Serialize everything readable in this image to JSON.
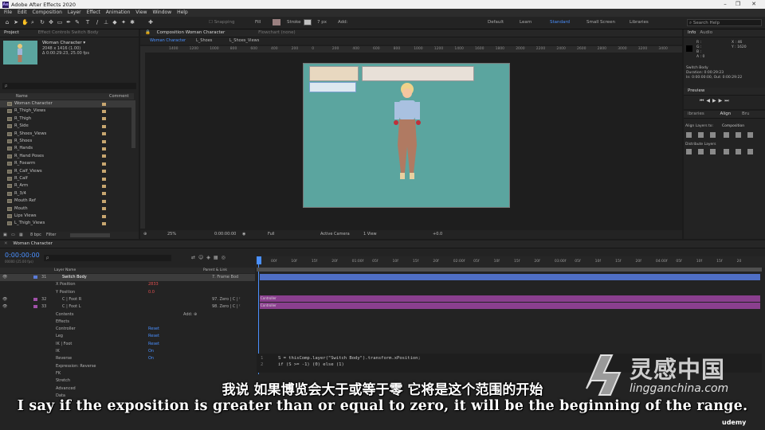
{
  "app": {
    "title": "Adobe After Effects 2020",
    "logo": "Ae",
    "window_buttons": [
      "–",
      "❐",
      "✕"
    ]
  },
  "menu": [
    "File",
    "Edit",
    "Composition",
    "Layer",
    "Effect",
    "Animation",
    "View",
    "Window",
    "Help"
  ],
  "toolbar": {
    "snapping": "Snapping",
    "fill": "Fill",
    "stroke": "Stroke",
    "stroke_px": "7 px",
    "add": "Add:",
    "workspaces": [
      "Default",
      "Learn",
      "Standard",
      "Small Screen",
      "Libraries"
    ],
    "active_workspace": "Standard",
    "search_placeholder": "Search Help"
  },
  "project": {
    "tab": "Project",
    "effect_controls_tab": "Effect Controls Switch Body",
    "comp_name": "Woman Character ▾",
    "comp_size": "2048 x 1416 (1.00)",
    "comp_duration": "Δ 0:00:29:23, 25.00 fps",
    "search_placeholder": "ρ",
    "col_name": "Name",
    "col_comment": "Comment",
    "items": [
      "Woman Character",
      "R_Thigh_Views",
      "R_Thigh",
      "R_Side",
      "R_Shoes_Views",
      "R_Shoes",
      "R_Hands",
      "R_Hand Poses",
      "R_Foearm",
      "R_Calf_Views",
      "R_Calf",
      "R_Arm",
      "R_3/4",
      "Mouth Ref",
      "Mouth",
      "Lips Views",
      "L_Thigh_Views"
    ],
    "footer_bpc": "8 bpc",
    "footer_filter": "Filter"
  },
  "composition": {
    "tab": "Composition Woman Character",
    "flowchart": "Flowchart (none)",
    "sub_tabs": [
      "Woman Character",
      "L_Shoes",
      "L_Shoes_Views"
    ],
    "ruler_labels": [
      "1400",
      "1200",
      "1000",
      "800",
      "600",
      "400",
      "200",
      "0",
      "200",
      "400",
      "600",
      "800",
      "1000",
      "1200",
      "1400",
      "1600",
      "1800",
      "2000",
      "2200",
      "2400",
      "2600",
      "2800",
      "3000",
      "3200",
      "3400"
    ],
    "zoom": "25%",
    "timecode": "0:00:00:00",
    "resolution": "Full",
    "camera": "Active Camera",
    "view": "1 View",
    "offset": "+0.0",
    "canvas_color": "#5ba59f"
  },
  "info": {
    "tab_info": "Info",
    "tab_audio": "Audio",
    "r": "R :",
    "g": "G :",
    "b": "B :",
    "a": "A : 0",
    "x": "X : 46",
    "y": "Y : 1620",
    "layer": "Switch Body",
    "duration": "Duration: 0:00:29:23",
    "inout": "In: 0:00:00:00, Out: 0:00:29:22"
  },
  "preview": {
    "tab": "Preview"
  },
  "align": {
    "tab_libraries": "ibraries",
    "tab_align": "Align",
    "tab_brush": "Bru",
    "align_to_label": "Align Layers to:",
    "align_to_value": "Composition",
    "distribute": "Distribute Layers"
  },
  "timeline": {
    "tab": "Woman Character",
    "timecode": "0:00:00:00",
    "timecode_sub": "00000 (25.00 fps)",
    "search_placeholder": "ρ",
    "col_layer_name": "Layer Name",
    "col_parent": "Parent & Link",
    "time_marks": [
      "00f",
      "10f",
      "15f",
      "20f",
      "01:00f",
      "05f",
      "10f",
      "15f",
      "20f",
      "02:00f",
      "05f",
      "10f",
      "15f",
      "20f",
      "03:00f",
      "05f",
      "10f",
      "15f",
      "20f",
      "04:00f",
      "05f",
      "10f",
      "15f",
      "20"
    ],
    "layers": [
      {
        "num": "31",
        "name": "Switch Body",
        "parent": "7. Frame Bod",
        "selected": true
      },
      {
        "num": "",
        "name": "X Position",
        "value": "2833",
        "prop": true
      },
      {
        "num": "",
        "name": "Y Position",
        "value": "0.0",
        "prop": true
      },
      {
        "num": "32",
        "name": "C | Foot R",
        "parent": "97. Zero | C | ⁽",
        "selected": false
      },
      {
        "num": "33",
        "name": "C | Foot L",
        "parent": "98. Zero | C | ⁽",
        "selected": false
      },
      {
        "num": "",
        "name": "Contents",
        "value": "Add: ⊕",
        "prop": true
      },
      {
        "num": "",
        "name": "Effects",
        "prop": true
      },
      {
        "num": "",
        "name": "Controller",
        "value": "Reset",
        "prop": true
      },
      {
        "num": "",
        "name": "Leg",
        "value": "Reset",
        "prop": true
      },
      {
        "num": "",
        "name": "IK | Foot",
        "value": "Reset",
        "prop": true
      },
      {
        "num": "",
        "name": "IK",
        "value": "On",
        "prop": true
      },
      {
        "num": "",
        "name": "Reverse",
        "value": "On",
        "prop": true
      },
      {
        "num": "",
        "name": "Expression: Reverse",
        "prop": true
      },
      {
        "num": "",
        "name": "FK",
        "prop": true
      },
      {
        "num": "",
        "name": "Stretch",
        "prop": true
      },
      {
        "num": "",
        "name": "Advanced",
        "prop": true
      },
      {
        "num": "",
        "name": "Data",
        "prop": true
      }
    ],
    "bar_labels": [
      "Controller",
      "Controller"
    ],
    "code_line1": "S = thisComp.layer(\"Switch Body\").transform.xPosition;",
    "code_line2": "if (S >= -1) (0) else (1)",
    "line_nums": [
      "1",
      "2"
    ]
  },
  "subtitles": {
    "cn": "我说 如果博览会大于或等于零 它将是这个范围的开始",
    "en": "I say if the exposition is greater than or equal to zero, it will be the beginning of the range."
  },
  "watermark": {
    "cn": "灵感中国",
    "url": "lingganchina.com",
    "udemy": "udemy"
  }
}
